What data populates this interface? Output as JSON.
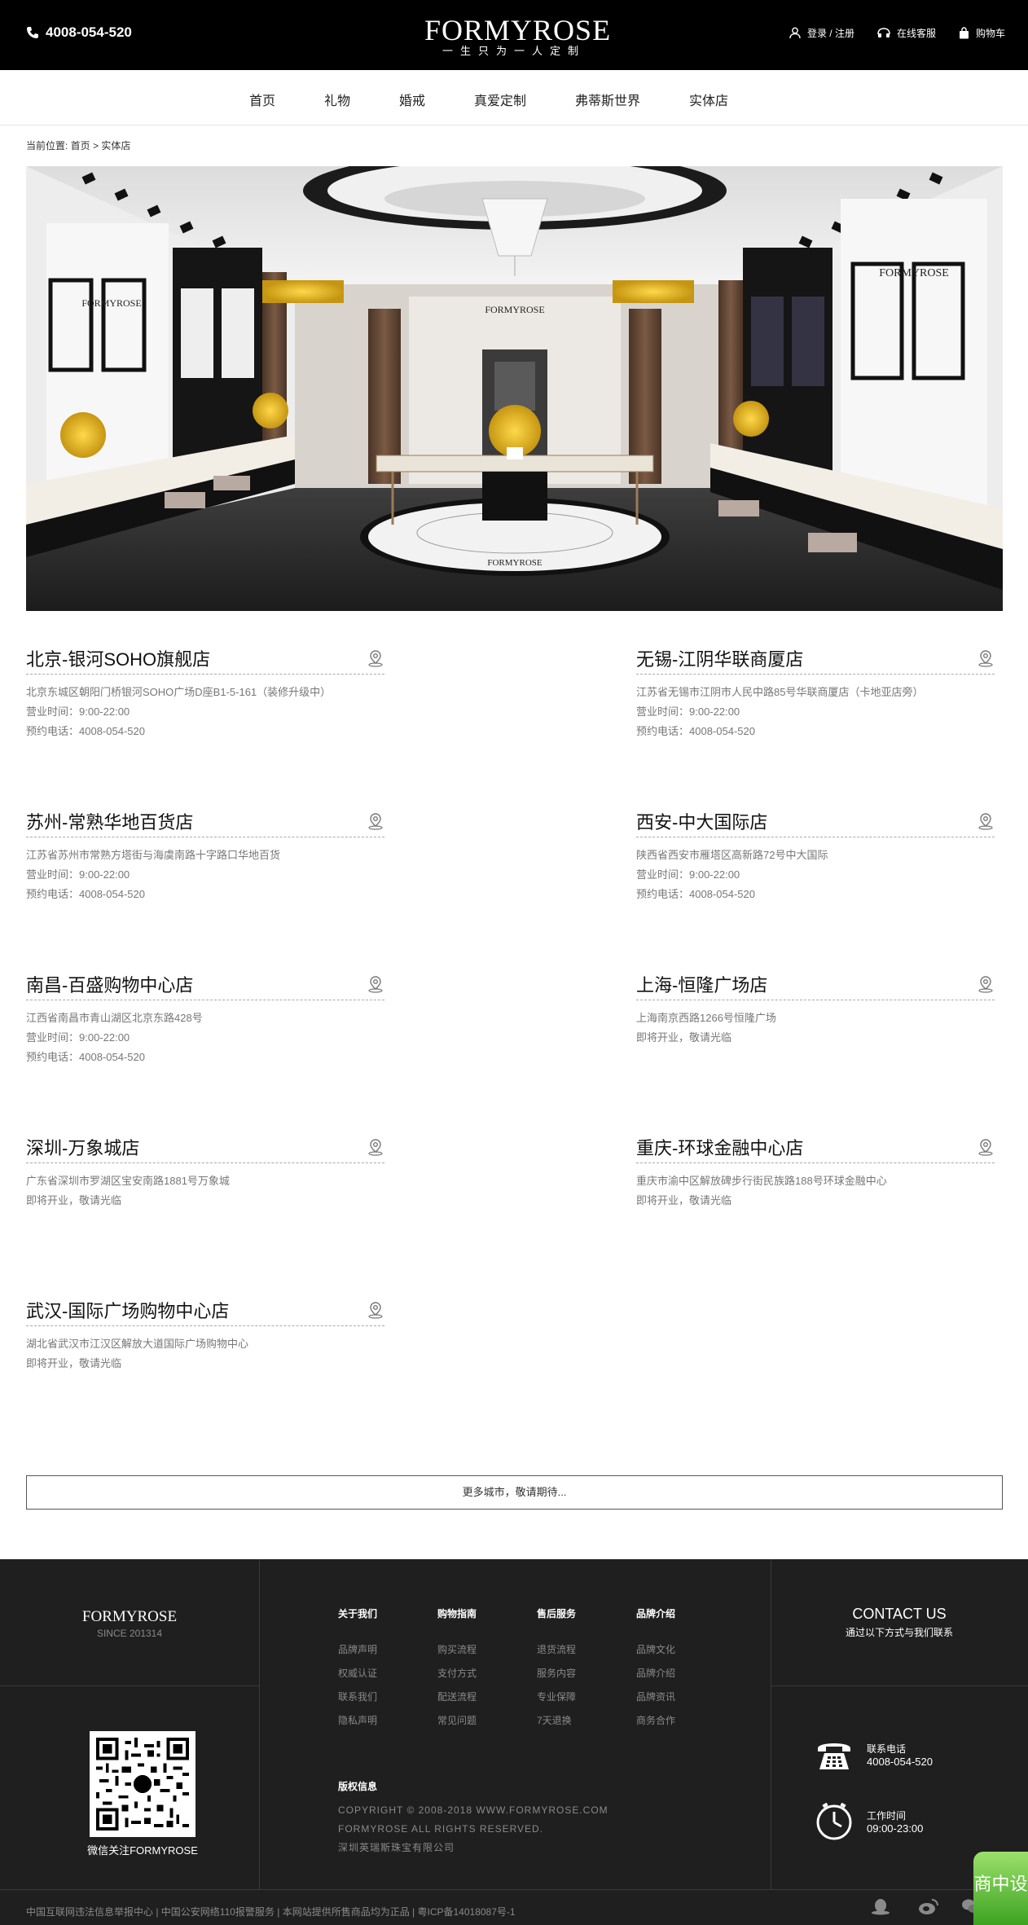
{
  "header": {
    "phone": "4008-054-520",
    "logo": "FORMYROSE",
    "slogan": "一生只为一人定制",
    "tools": [
      {
        "label": "登录 / 注册",
        "icon": "user-icon"
      },
      {
        "label": "在线客服",
        "icon": "headset-icon"
      },
      {
        "label": "购物车",
        "icon": "bag-icon"
      }
    ]
  },
  "nav": [
    "首页",
    "礼物",
    "婚戒",
    "真爱定制",
    "弗蒂斯世界",
    "实体店"
  ],
  "breadcrumb": {
    "prefix": "当前位置: ",
    "home": "首页",
    "sep": ">",
    "current": "实体店"
  },
  "hero": {
    "sign_top": "FORMYROSE",
    "sign_left": "FORMYROSE",
    "sign_right": "FORMYROSE",
    "sign_floor": "FORMYROSE"
  },
  "stores": [
    {
      "name": "北京-银河SOHO旗舰店",
      "lines": [
        "北京东城区朝阳门桥银河SOHO广场D座B1-5-161（装修升级中）",
        "营业时间：9:00-22:00",
        "预约电话：4008-054-520"
      ]
    },
    {
      "name": "无锡-江阴华联商厦店",
      "lines": [
        "江苏省无锡市江阴市人民中路85号华联商厦店（卡地亚店旁）",
        "营业时间：9:00-22:00",
        "预约电话：4008-054-520"
      ]
    },
    {
      "name": "苏州-常熟华地百货店",
      "lines": [
        "江苏省苏州市常熟方塔街与海虞南路十字路口华地百货",
        "营业时间：9:00-22:00",
        "预约电话：4008-054-520"
      ]
    },
    {
      "name": "西安-中大国际店",
      "lines": [
        "陕西省西安市雁塔区高新路72号中大国际",
        "营业时间：9:00-22:00",
        "预约电话：4008-054-520"
      ]
    },
    {
      "name": "南昌-百盛购物中心店",
      "lines": [
        "江西省南昌市青山湖区北京东路428号",
        "营业时间：9:00-22:00",
        "预约电话：4008-054-520"
      ]
    },
    {
      "name": "上海-恒隆广场店",
      "lines": [
        "上海南京西路1266号恒隆广场",
        "即将开业，敬请光临"
      ]
    },
    {
      "name": "深圳-万象城店",
      "lines": [
        "广东省深圳市罗湖区宝安南路1881号万象城",
        "即将开业，敬请光临"
      ]
    },
    {
      "name": "重庆-环球金融中心店",
      "lines": [
        "重庆市渝中区解放碑步行街民族路188号环球金融中心",
        "即将开业，敬请光临"
      ]
    },
    {
      "name": "武汉-国际广场购物中心店",
      "lines": [
        "湖北省武汉市江汉区解放大道国际广场购物中心",
        "即将开业，敬请光临"
      ]
    }
  ],
  "more_button": "更多城市，敬请期待...",
  "footer": {
    "brand": "FORMYROSE",
    "since": "SINCE 201314",
    "qr_caption": "微信关注FORMYROSE",
    "columns": [
      {
        "title": "关于我们",
        "links": [
          "品牌声明",
          "权威认证",
          "联系我们",
          "隐私声明"
        ]
      },
      {
        "title": "购物指南",
        "links": [
          "购买流程",
          "支付方式",
          "配送流程",
          "常见问题"
        ]
      },
      {
        "title": "售后服务",
        "links": [
          "退货流程",
          "服务内容",
          "专业保障",
          "7天退换"
        ]
      },
      {
        "title": "品牌介绍",
        "links": [
          "品牌文化",
          "品牌介绍",
          "品牌资讯",
          "商务合作"
        ]
      }
    ],
    "copyright": {
      "title": "版权信息",
      "lines": [
        "COPYRIGHT © 2008-2018 WWW.FORMYROSE.COM",
        "FORMYROSE ALL RIGHTS RESERVED.",
        "深圳英瑞斯珠宝有限公司"
      ]
    },
    "contact": {
      "title": "CONTACT US",
      "subtitle": "通过以下方式与我们联系"
    },
    "phone": {
      "label": "联系电话",
      "value": "4008-054-520"
    },
    "hours": {
      "label": "工作时间",
      "value": "09:00-23:00"
    },
    "legal": "中国互联网违法信息举报中心 | 中国公安网络110报警服务 | 本网站提供所售商品均为正品 | 粤ICP备14018087号-1",
    "chat_badge": "商中设"
  }
}
